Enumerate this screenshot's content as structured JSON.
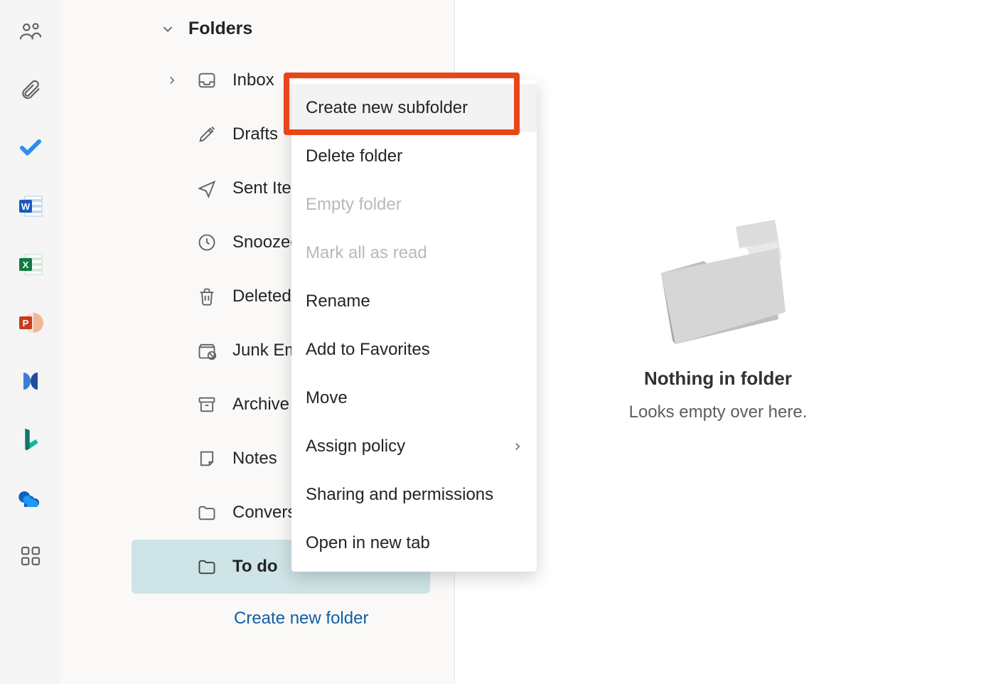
{
  "rail": {
    "items": [
      "people",
      "attach",
      "todo",
      "word",
      "excel",
      "powerpoint",
      "viva",
      "bing",
      "onedrive",
      "apps"
    ]
  },
  "sidebar": {
    "section_title": "Folders",
    "folders": [
      {
        "label": "Inbox",
        "icon": "inbox",
        "expandable": true
      },
      {
        "label": "Drafts",
        "icon": "drafts"
      },
      {
        "label": "Sent Items",
        "icon": "sent"
      },
      {
        "label": "Snoozed",
        "icon": "snoozed"
      },
      {
        "label": "Deleted Items",
        "icon": "deleted"
      },
      {
        "label": "Junk Email",
        "icon": "junk"
      },
      {
        "label": "Archive",
        "icon": "archive"
      },
      {
        "label": "Notes",
        "icon": "notes"
      },
      {
        "label": "Conversation History",
        "icon": "folder"
      },
      {
        "label": "To do",
        "icon": "folder",
        "selected": true
      }
    ],
    "create_new_folder": "Create new folder"
  },
  "context_menu": {
    "items": [
      {
        "label": "Create new subfolder",
        "hovered": true
      },
      {
        "label": "Delete folder"
      },
      {
        "label": "Empty folder",
        "disabled": true
      },
      {
        "label": "Mark all as read",
        "disabled": true
      },
      {
        "label": "Rename"
      },
      {
        "label": "Add to Favorites"
      },
      {
        "label": "Move"
      },
      {
        "label": "Assign policy",
        "submenu": true
      },
      {
        "label": "Sharing and permissions"
      },
      {
        "label": "Open in new tab"
      }
    ]
  },
  "content": {
    "empty_title": "Nothing in folder",
    "empty_sub": "Looks empty over here."
  }
}
